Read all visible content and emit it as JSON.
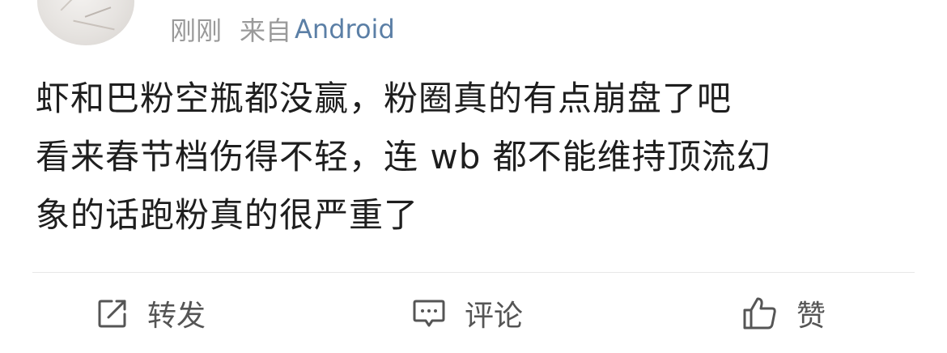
{
  "post": {
    "meta": {
      "time": "刚刚",
      "from_prefix": "来自",
      "source": "Android"
    },
    "content_lines": [
      "虾和巴粉空瓶都没赢，粉圈真的有点崩盘了吧",
      "看来春节档伤得不轻，连 wb 都不能维持顶流幻",
      "象的话跑粉真的很严重了"
    ]
  },
  "actions": {
    "repost_label": "转发",
    "comment_label": "评论",
    "like_label": "赞"
  },
  "icons": {
    "repost": "share-edit-icon",
    "comment": "comment-icon",
    "like": "thumbs-up-icon"
  },
  "colors": {
    "source_link": "#5b7fa6",
    "meta_text": "#9a9a9a",
    "body_text": "#1e1e1e",
    "action_text": "#555555"
  }
}
